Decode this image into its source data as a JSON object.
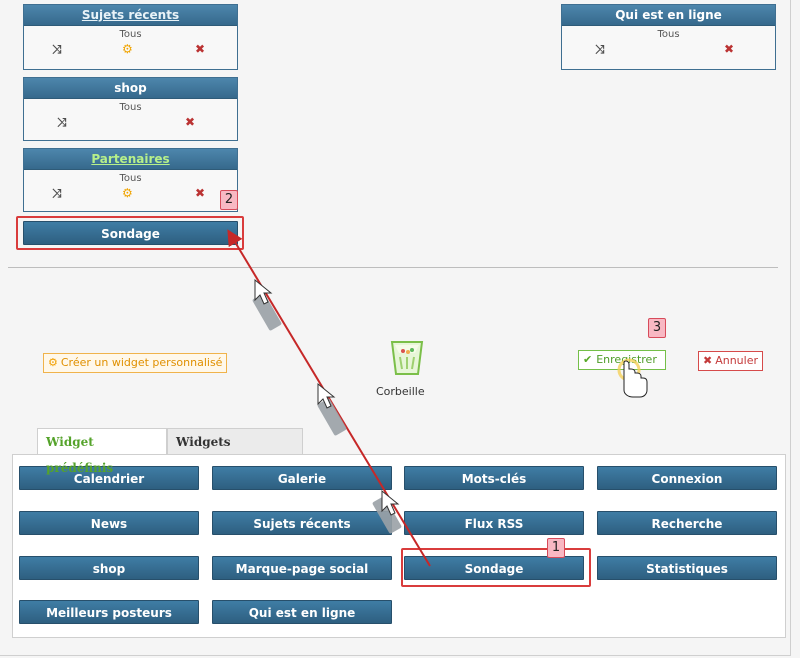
{
  "placed": {
    "box1_title": "Sujets récents",
    "box1_sub": "Tous",
    "box2_title": "shop",
    "box2_sub": "Tous",
    "box3_title": "Partenaires",
    "box3_sub": "Tous",
    "box4_title": "Sondage",
    "right_title": "Qui est en ligne",
    "right_sub": "Tous"
  },
  "actions": {
    "custom_widget": "Créer un widget personnalisé",
    "trash": "Corbeille",
    "save": "Enregistrer",
    "cancel": "Annuler"
  },
  "tabs": [
    "Widget prédéfinis",
    "Widgets personnels"
  ],
  "widgets": [
    [
      "Calendrier",
      "Galerie",
      "Mots-clés",
      "Connexion"
    ],
    [
      "News",
      "Sujets récents",
      "Flux RSS",
      "Recherche"
    ],
    [
      "shop",
      "Marque-page social",
      "Sondage",
      "Statistiques"
    ],
    [
      "Meilleurs posteurs",
      "Qui est en ligne"
    ]
  ],
  "annotations": [
    "1",
    "2",
    "3"
  ],
  "colors": {
    "bar_blue": "#3a7097",
    "accent_green": "#55a32b",
    "alert_red": "#d93c3c",
    "callout_pink": "#f8b8c3"
  },
  "icons": [
    "move-icon",
    "settings-icon",
    "delete-icon",
    "trash-icon",
    "check-icon",
    "cancel-icon",
    "hand-cursor-icon",
    "arrow-cursor-icon"
  ]
}
